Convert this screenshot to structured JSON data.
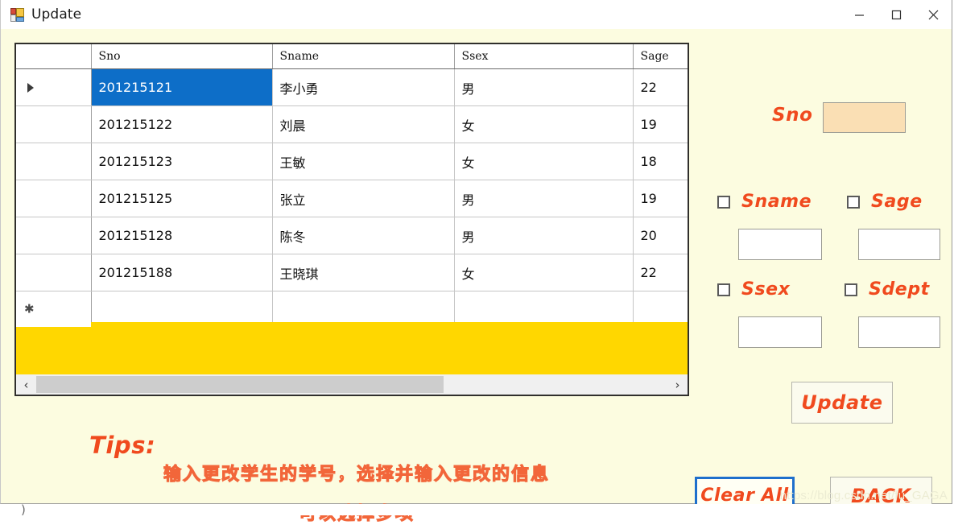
{
  "window": {
    "title": "Update",
    "icon": "app-window-icon",
    "controls": {
      "minimize": "minimize-icon",
      "maximize": "maximize-icon",
      "close": "close-icon"
    }
  },
  "grid": {
    "columns": [
      "",
      "Sno",
      "Sname",
      "Ssex",
      "Sage"
    ],
    "rows": [
      {
        "indicator": "▶",
        "sno": "201215121",
        "sname": "李小勇",
        "ssex": "男",
        "sage": "22",
        "selected": true
      },
      {
        "indicator": "",
        "sno": "201215122",
        "sname": "刘晨",
        "ssex": "女",
        "sage": "19",
        "selected": false
      },
      {
        "indicator": "",
        "sno": "201215123",
        "sname": "王敏",
        "ssex": "女",
        "sage": "18",
        "selected": false
      },
      {
        "indicator": "",
        "sno": "201215125",
        "sname": "张立",
        "ssex": "男",
        "sage": "19",
        "selected": false
      },
      {
        "indicator": "",
        "sno": "201215128",
        "sname": "陈冬",
        "ssex": "男",
        "sage": "20",
        "selected": false
      },
      {
        "indicator": "",
        "sno": "201215188",
        "sname": "王晓琪",
        "ssex": "女",
        "sage": "22",
        "selected": false
      },
      {
        "indicator": "*",
        "sno": "",
        "sname": "",
        "ssex": "",
        "sage": "",
        "selected": false
      }
    ],
    "empty_area_color": "#FFD700",
    "selection_color": "#0D6EC8",
    "scrollbar": {
      "left_arrow": "‹",
      "right_arrow": "›",
      "thumb_fraction": "0.645"
    }
  },
  "panel": {
    "sno": {
      "label": "Sno",
      "value": "",
      "placeholder": "",
      "field_color": "#FADFB4"
    },
    "fields": [
      {
        "name": "sname",
        "label": "Sname",
        "checked": false,
        "value": "",
        "placeholder": ""
      },
      {
        "name": "sage",
        "label": "Sage",
        "checked": false,
        "value": "",
        "placeholder": ""
      },
      {
        "name": "ssex",
        "label": "Ssex",
        "checked": false,
        "value": "",
        "placeholder": ""
      },
      {
        "name": "sdept",
        "label": "Sdept",
        "checked": false,
        "value": "",
        "placeholder": ""
      }
    ],
    "update_button": "Update"
  },
  "tips": {
    "label": "Tips:",
    "line1": "输入更改学生的学号，选择并输入更改的信息",
    "line2": "可以选择多项"
  },
  "footer": {
    "clear_button": "Clear All",
    "back_button": "BACK"
  },
  "watermark": "https://blog.csdn.net/fu_GAGA",
  "theme": {
    "form_background": "#FCFCE0",
    "accent_text": "#F04A1E",
    "focus_border": "#1E6FCC"
  }
}
